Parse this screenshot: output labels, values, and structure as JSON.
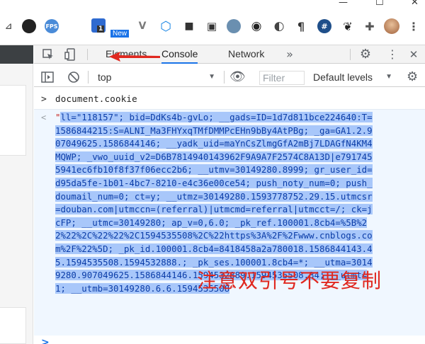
{
  "window": {
    "controls": [
      "—",
      "☐",
      "✕"
    ]
  },
  "extensions": {
    "items": [
      {
        "name": "ext-pin",
        "glyph": "⊿",
        "color": "#555"
      },
      {
        "name": "ext-shield",
        "glyph": "●",
        "color": "#222"
      },
      {
        "name": "ext-fps",
        "glyph": "FPS",
        "color": "#4a8bd8"
      },
      {
        "name": "ext-new",
        "glyph": "1",
        "color": "#2e6ad0",
        "badge": "New"
      },
      {
        "name": "ext-v",
        "glyph": "V",
        "color": "#7a7a7a"
      },
      {
        "name": "ext-hex",
        "glyph": "⬡",
        "color": "#1e88e5"
      },
      {
        "name": "ext-cube",
        "glyph": "■",
        "color": "#333"
      },
      {
        "name": "ext-frame",
        "glyph": "▣",
        "color": "#333"
      },
      {
        "name": "ext-color",
        "glyph": "●",
        "color": "#6a8fb0"
      },
      {
        "name": "ext-cam",
        "glyph": "◉",
        "color": "#222"
      },
      {
        "name": "ext-moon",
        "glyph": "◐",
        "color": "#444"
      },
      {
        "name": "ext-para",
        "glyph": "¶",
        "color": "#333"
      },
      {
        "name": "ext-hash",
        "glyph": "#",
        "color": "#1f4f8a"
      },
      {
        "name": "ext-leaf",
        "glyph": "❦",
        "color": "#222"
      },
      {
        "name": "ext-puzzle",
        "glyph": "✚",
        "color": "#555"
      },
      {
        "name": "ext-avatar",
        "glyph": "",
        "color": "#c9956b"
      },
      {
        "name": "ext-menu",
        "glyph": "⋮",
        "color": "#555"
      }
    ],
    "new_badge": "New"
  },
  "devtools": {
    "tabs": [
      {
        "label": "Elements",
        "active": false
      },
      {
        "label": "Console",
        "active": true
      },
      {
        "label": "Network",
        "active": false
      }
    ],
    "context": "top",
    "filter_placeholder": "Filter",
    "levels": "Default levels"
  },
  "console": {
    "input_prompt": ">",
    "command": "document.cookie",
    "result_marker": "<",
    "result_lines": [
      "\"ll=\"118157\"; bid=DdKs4b-gvLo; __gads=ID=1d7d811bce224640:T=",
      "1586844215:S=ALNI_Ma3FHYxqTMfDMMPcEHn9bBy4AtPBg; _ga=GA1.2.9",
      "07049625.1586844146; __yadk_uid=maYnCsZlmgGfA2mBj7LDAGfN4KM4",
      "MQWP; _vwo_uuid_v2=D6B7814940143962F9A9A7F2574C8A13D|e791745",
      "5941ec6fb10f8f37f06ecc2b6; __utmv=30149280.8999; gr_user_id=",
      "d95da5fe-1b01-4bc7-8210-e4c36e00ce54; push_noty_num=0; push_",
      "doumail_num=0; ct=y; __utmz=30149280.1593778752.29.15.utmcsr",
      "=douban.com|utmccn=(referral)|utmcmd=referral|utmcct=/; ck=j",
      "cFP; __utmc=30149280; ap_v=0,6.0; _pk_ref.100001.8cb4=%5B%2",
      "2%22%2C%22%22%2C1594535508%2C%22https%3A%2F%2Fwww.cnblogs.co",
      "m%2F%22%5D; _pk_id.100001.8cb4=8418458a2a780018.1586844143.4",
      "5.1594535508.1594532888.; _pk_ses.100001.8cb4=*; __utma=3014",
      "9280.907049625.1586844146.1594532889.1594535508.34; __utmt=",
      "1; __utmb=30149280.6.6.1594535508\""
    ],
    "next_prompt": ">"
  },
  "annotation": {
    "note": "注意双引号不要复制"
  },
  "colors": {
    "string": "#c41a16",
    "selection": "#a8c7fa",
    "accent": "#1a73e8",
    "note": "#e0281f"
  }
}
